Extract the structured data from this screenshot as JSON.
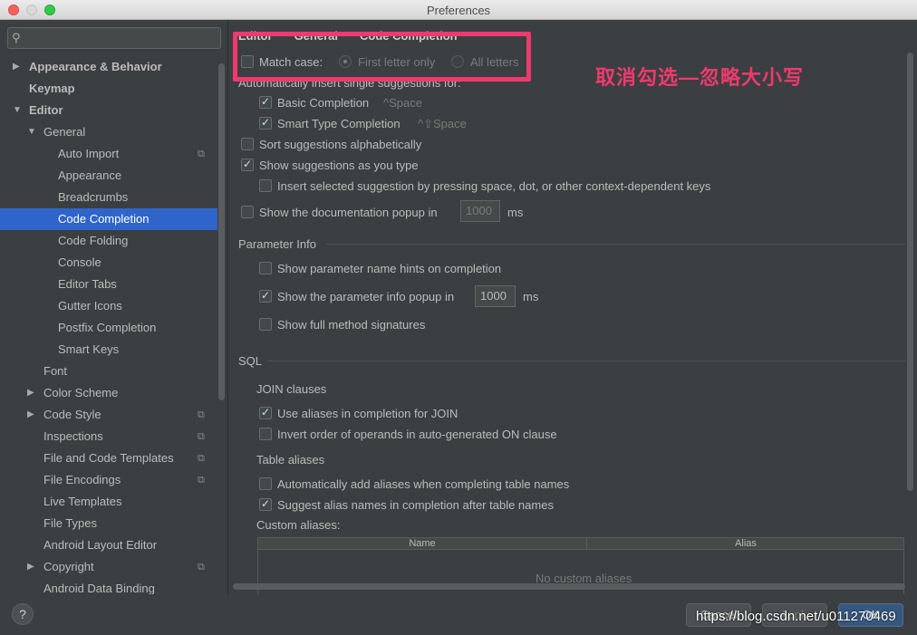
{
  "window": {
    "title": "Preferences"
  },
  "search": {
    "placeholder": ""
  },
  "sidebar": {
    "items": [
      {
        "label": "Appearance & Behavior",
        "bold": true,
        "arrow": "▶",
        "indent": 0,
        "copy": false
      },
      {
        "label": "Keymap",
        "bold": true,
        "arrow": "",
        "indent": 0,
        "copy": false
      },
      {
        "label": "Editor",
        "bold": true,
        "arrow": "▼",
        "indent": 0,
        "copy": false
      },
      {
        "label": "General",
        "bold": false,
        "arrow": "▼",
        "indent": 1,
        "copy": false
      },
      {
        "label": "Auto Import",
        "bold": false,
        "arrow": "",
        "indent": 2,
        "copy": true
      },
      {
        "label": "Appearance",
        "bold": false,
        "arrow": "",
        "indent": 2,
        "copy": false
      },
      {
        "label": "Breadcrumbs",
        "bold": false,
        "arrow": "",
        "indent": 2,
        "copy": false
      },
      {
        "label": "Code Completion",
        "bold": false,
        "arrow": "",
        "indent": 2,
        "copy": false,
        "selected": true
      },
      {
        "label": "Code Folding",
        "bold": false,
        "arrow": "",
        "indent": 2,
        "copy": false
      },
      {
        "label": "Console",
        "bold": false,
        "arrow": "",
        "indent": 2,
        "copy": false
      },
      {
        "label": "Editor Tabs",
        "bold": false,
        "arrow": "",
        "indent": 2,
        "copy": false
      },
      {
        "label": "Gutter Icons",
        "bold": false,
        "arrow": "",
        "indent": 2,
        "copy": false
      },
      {
        "label": "Postfix Completion",
        "bold": false,
        "arrow": "",
        "indent": 2,
        "copy": false
      },
      {
        "label": "Smart Keys",
        "bold": false,
        "arrow": "",
        "indent": 2,
        "copy": false
      },
      {
        "label": "Font",
        "bold": false,
        "arrow": "",
        "indent": 1,
        "copy": false
      },
      {
        "label": "Color Scheme",
        "bold": false,
        "arrow": "▶",
        "indent": 1,
        "copy": false
      },
      {
        "label": "Code Style",
        "bold": false,
        "arrow": "▶",
        "indent": 1,
        "copy": true
      },
      {
        "label": "Inspections",
        "bold": false,
        "arrow": "",
        "indent": 1,
        "copy": true
      },
      {
        "label": "File and Code Templates",
        "bold": false,
        "arrow": "",
        "indent": 1,
        "copy": true
      },
      {
        "label": "File Encodings",
        "bold": false,
        "arrow": "",
        "indent": 1,
        "copy": true
      },
      {
        "label": "Live Templates",
        "bold": false,
        "arrow": "",
        "indent": 1,
        "copy": false
      },
      {
        "label": "File Types",
        "bold": false,
        "arrow": "",
        "indent": 1,
        "copy": false
      },
      {
        "label": "Android Layout Editor",
        "bold": false,
        "arrow": "",
        "indent": 1,
        "copy": false
      },
      {
        "label": "Copyright",
        "bold": false,
        "arrow": "▶",
        "indent": 1,
        "copy": true
      },
      {
        "label": "Android Data Binding",
        "bold": false,
        "arrow": "",
        "indent": 1,
        "copy": false
      }
    ]
  },
  "breadcrumb": [
    "Editor",
    "General",
    "Code Completion"
  ],
  "match_case": {
    "label": "Match case:",
    "checked": false,
    "first_letter": "First letter only",
    "all_letters": "All letters",
    "selected": "First letter only"
  },
  "auto_insert": {
    "label": "Automatically insert single suggestions for:",
    "basic": {
      "label": "Basic Completion",
      "shortcut": "^Space",
      "checked": true
    },
    "smart": {
      "label": "Smart Type Completion",
      "shortcut": "^⇧Space",
      "checked": true
    }
  },
  "sort_alpha": {
    "label": "Sort suggestions alphabetically",
    "checked": false
  },
  "show_as_type": {
    "label": "Show suggestions as you type",
    "checked": true
  },
  "insert_selected": {
    "label": "Insert selected suggestion by pressing space, dot, or other context-dependent keys",
    "checked": false
  },
  "doc_popup": {
    "label": "Show the documentation popup in",
    "value": "1000",
    "unit": "ms",
    "checked": false
  },
  "parameter_info": {
    "title": "Parameter Info",
    "name_hints": {
      "label": "Show parameter name hints on completion",
      "checked": false
    },
    "info_popup": {
      "label": "Show the parameter info popup in",
      "value": "1000",
      "unit": "ms",
      "checked": true
    },
    "full_sig": {
      "label": "Show full method signatures",
      "checked": false
    }
  },
  "sql": {
    "title": "SQL",
    "join_title": "JOIN clauses",
    "use_aliases": {
      "label": "Use aliases in completion for JOIN",
      "checked": true
    },
    "invert_order": {
      "label": "Invert order of operands in auto-generated ON clause",
      "checked": false
    },
    "table_aliases_title": "Table aliases",
    "auto_add": {
      "label": "Automatically add aliases when completing table names",
      "checked": false
    },
    "suggest_alias": {
      "label": "Suggest alias names in completion after table names",
      "checked": true
    },
    "custom_aliases": "Custom aliases:",
    "columns": [
      "Name",
      "Alias"
    ],
    "empty_text": "No custom aliases"
  },
  "annotation": "取消勾选—忽略大小写",
  "footer": {
    "help": "?",
    "cancel": "Cancel",
    "apply": "Apply",
    "ok": "OK"
  },
  "watermark": "https://blog.csdn.net/u011270469",
  "colors": {
    "accent": "#ef3a6f",
    "selection": "#2f65ca",
    "background": "#3c3f41"
  }
}
